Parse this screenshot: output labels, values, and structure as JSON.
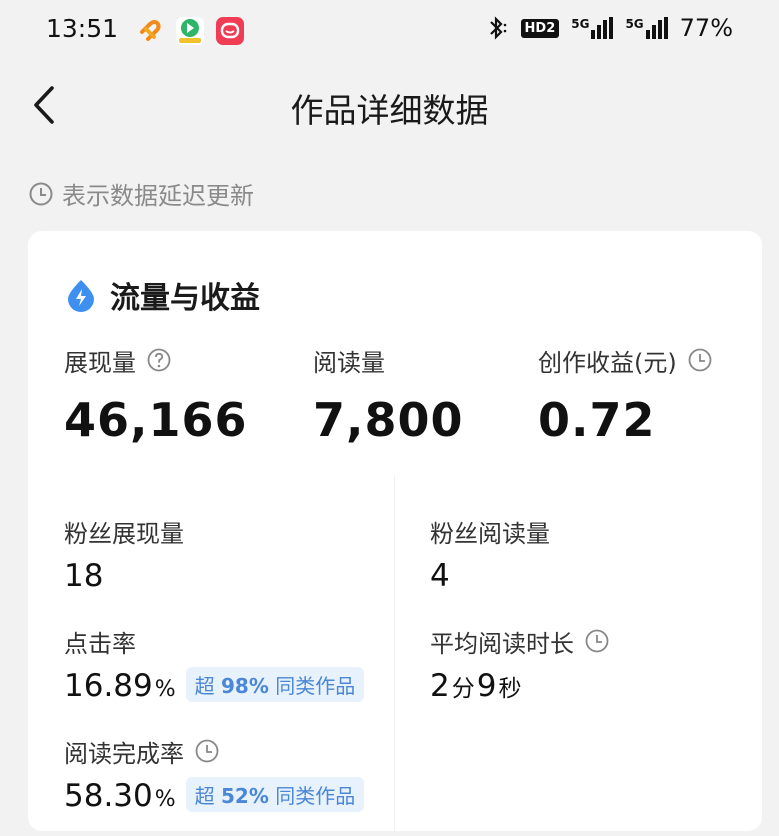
{
  "status_bar": {
    "time": "13:51",
    "battery": "77%",
    "network_a": "5G",
    "network_b": "5G",
    "hd": "HD2"
  },
  "nav": {
    "title": "作品详细数据"
  },
  "notice": {
    "text": "表示数据延迟更新"
  },
  "section": {
    "title": "流量与收益",
    "metrics": [
      {
        "label": "展现量",
        "value": "46,166"
      },
      {
        "label": "阅读量",
        "value": "7,800"
      },
      {
        "label": "创作收益(元)",
        "value": "0.72"
      }
    ]
  },
  "stats": {
    "fan_impressions": {
      "label": "粉丝展现量",
      "value": "18"
    },
    "fan_reads": {
      "label": "粉丝阅读量",
      "value": "4"
    },
    "ctr": {
      "label": "点击率",
      "value": "16.89",
      "unit": "%",
      "badge_prefix": "超",
      "badge_pct": "98%",
      "badge_suffix": "同类作品"
    },
    "avg_read_time": {
      "label": "平均阅读时长",
      "minutes": "2",
      "minute_unit": "分",
      "seconds": "9",
      "second_unit": "秒"
    },
    "completion": {
      "label": "阅读完成率",
      "value": "58.30",
      "unit": "%",
      "badge_prefix": "超",
      "badge_pct": "52%",
      "badge_suffix": "同类作品"
    }
  },
  "colors": {
    "accent_blue": "#3d8ff0",
    "badge_bg": "#e8f2fd",
    "badge_text": "#4a87d6"
  }
}
